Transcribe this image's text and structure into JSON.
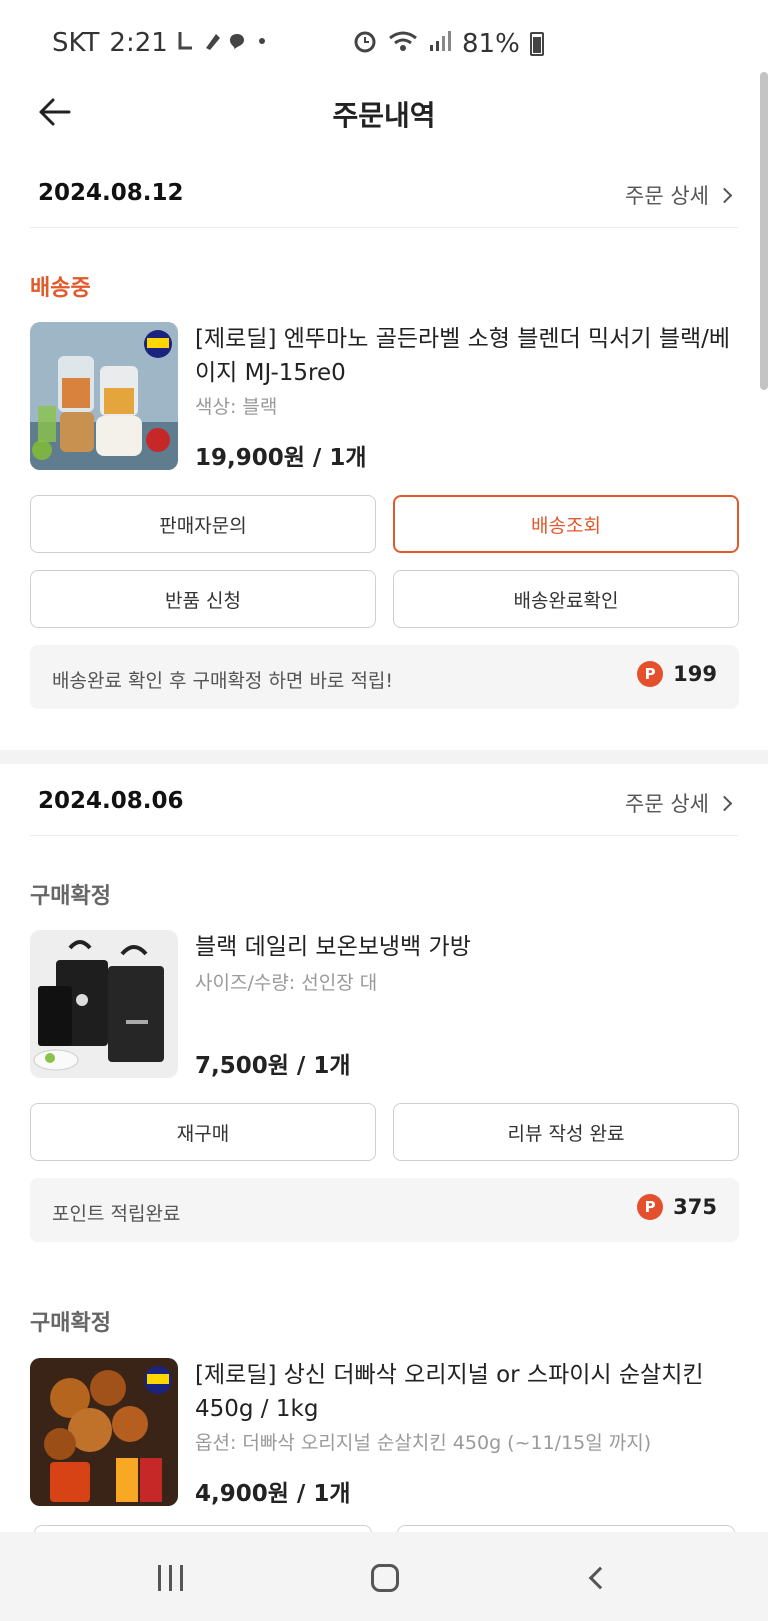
{
  "status_bar": {
    "carrier": "SKT",
    "time": "2:21",
    "battery": "81%"
  },
  "header": {
    "title": "주문내역"
  },
  "orders": [
    {
      "date": "2024.08.12",
      "detail_label": "주문 상세",
      "status": "배송중",
      "item": {
        "title": "[제로딜] 엔뚜마노 골든라벨 소형 블렌더 믹서기 블랙/베이지 MJ-15re0",
        "option": "색상: 블랙",
        "price": "19,900원 / 1개"
      },
      "buttons": [
        "판매자문의",
        "배송조회",
        "반품 신청",
        "배송완료확인"
      ],
      "points": {
        "text": "배송완료 확인 후 구매확정 하면 바로 적립!",
        "value": "199"
      }
    },
    {
      "date": "2024.08.06",
      "detail_label": "주문 상세",
      "status": "구매확정",
      "item": {
        "title": "블랙 데일리 보온보냉백 가방",
        "option": "사이즈/수량: 선인장 대",
        "price": "7,500원 / 1개"
      },
      "buttons": [
        "재구매",
        "리뷰 작성 완료"
      ],
      "points": {
        "text": "포인트 적립완료",
        "value": "375"
      }
    },
    {
      "status": "구매확정",
      "item": {
        "title": "[제로딜] 상신 더빠삭 오리지널 or 스파이시 순살치킨 450g / 1kg",
        "option": "옵션: 더빠삭 오리지널 순살치킨 450g (~11/15일 까지)",
        "price": "4,900원 / 1개"
      }
    }
  ],
  "points_icon": "P",
  "colors": {
    "accent": "#e25a2c",
    "point_badge": "#e4502d"
  }
}
